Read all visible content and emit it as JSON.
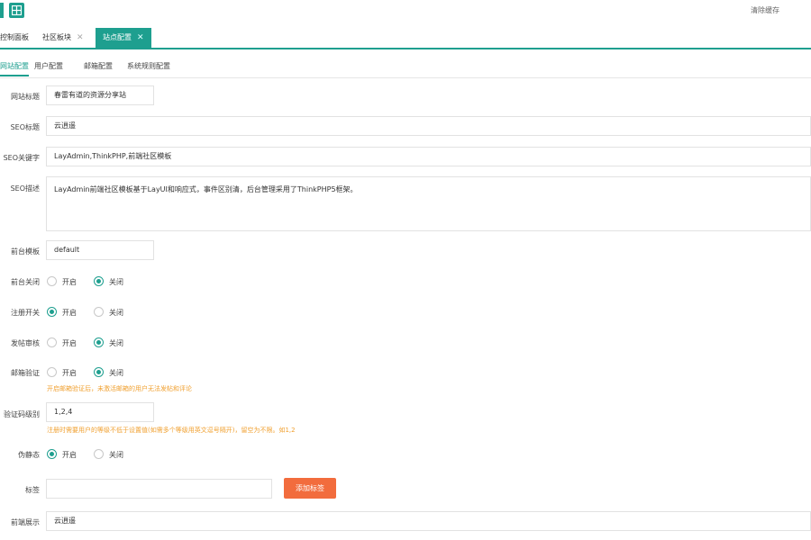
{
  "header": {
    "clear_cache": "清除缓存"
  },
  "tabs": [
    {
      "label": "控制面板"
    },
    {
      "label": "社区板块"
    },
    {
      "label": "站点配置"
    }
  ],
  "subtabs": [
    "网站配置",
    "用户配置",
    "邮箱配置",
    "系统规则配置"
  ],
  "form": {
    "site_name": {
      "label": "网站标题",
      "value": "春雷有道的资源分享站"
    },
    "seo_keyword": {
      "label": "SEO标题",
      "value": "云逍遥"
    },
    "seo_tags": {
      "label": "SEO关键字",
      "value": "LayAdmin,ThinkPHP,前端社区模板"
    },
    "seo_desc": {
      "label": "SEO描述",
      "value": "LayAdmin前端社区模板基于LayUI和响应式，事件区别清，后台管理采用了ThinkPHP5框架。"
    },
    "template": {
      "label": "前台模板",
      "value": "default"
    },
    "site_close": {
      "label": "前台关闭",
      "options": [
        "开启",
        "关闭"
      ],
      "selected": 1
    },
    "reg_open": {
      "label": "注册开关",
      "options": [
        "开启",
        "关闭"
      ],
      "selected": 0
    },
    "post_audit": {
      "label": "发帖审核",
      "options": [
        "开启",
        "关闭"
      ],
      "selected": 1
    },
    "email_verify": {
      "label": "邮箱验证",
      "options": [
        "开启",
        "关闭"
      ],
      "selected": 1,
      "hint": "开启邮箱验证后，未激活邮箱的用户无法发帖和评论"
    },
    "level_limit": {
      "label": "验证码级别",
      "value": "1,2,4",
      "hint": "注册时需要用户的等级不低于设置值(如需多个等级用英文逗号隔开)，留空为不限。如1,2"
    },
    "cache": {
      "label": "伪静态",
      "options": [
        "开启",
        "关闭"
      ],
      "selected": 0
    },
    "tags": {
      "label": "标签",
      "value": "",
      "button": "添加标签"
    },
    "footer_row": {
      "label": "前端展示",
      "value": "云逍遥"
    }
  }
}
